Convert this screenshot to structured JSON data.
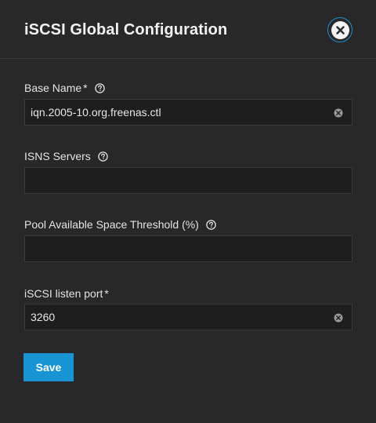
{
  "dialog": {
    "title": "iSCSI Global Configuration",
    "close_icon": "close-circle-icon"
  },
  "fields": {
    "base_name": {
      "label": "Base Name",
      "required_mark": "*",
      "value": "iqn.2005-10.org.freenas.ctl",
      "placeholder": ""
    },
    "isns_servers": {
      "label": "ISNS Servers",
      "value": "",
      "placeholder": ""
    },
    "pool_threshold": {
      "label": "Pool Available Space Threshold (%)",
      "value": "",
      "placeholder": ""
    },
    "listen_port": {
      "label": "iSCSI listen port",
      "required_mark": "*",
      "value": "3260",
      "placeholder": ""
    }
  },
  "actions": {
    "save_label": "Save"
  },
  "colors": {
    "background": "#282828",
    "input_background": "#1e1e1e",
    "accent": "#1694d4",
    "text": "#e8e8e8"
  }
}
